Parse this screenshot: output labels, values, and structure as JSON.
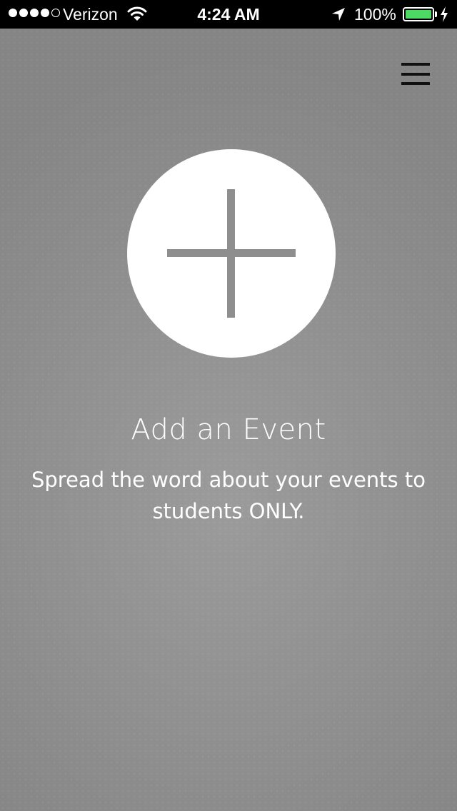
{
  "status_bar": {
    "signal_filled": 4,
    "signal_total": 5,
    "carrier": "Verizon",
    "time": "4:24 AM",
    "battery_percent": "100%",
    "battery_level": 1.0,
    "battery_color": "#4cd964",
    "icons": [
      "wifi-icon",
      "location-arrow-icon",
      "battery-icon",
      "charging-bolt-icon"
    ]
  },
  "header": {
    "menu_icon": "hamburger-menu-icon"
  },
  "main": {
    "add_icon": "plus-icon",
    "title": "Add an Event",
    "description": "Spread the word about your events to students ONLY."
  },
  "colors": {
    "background": "#8f8f8f",
    "circle": "#ffffff",
    "plus": "#8e8e8e",
    "text": "#ffffff"
  }
}
